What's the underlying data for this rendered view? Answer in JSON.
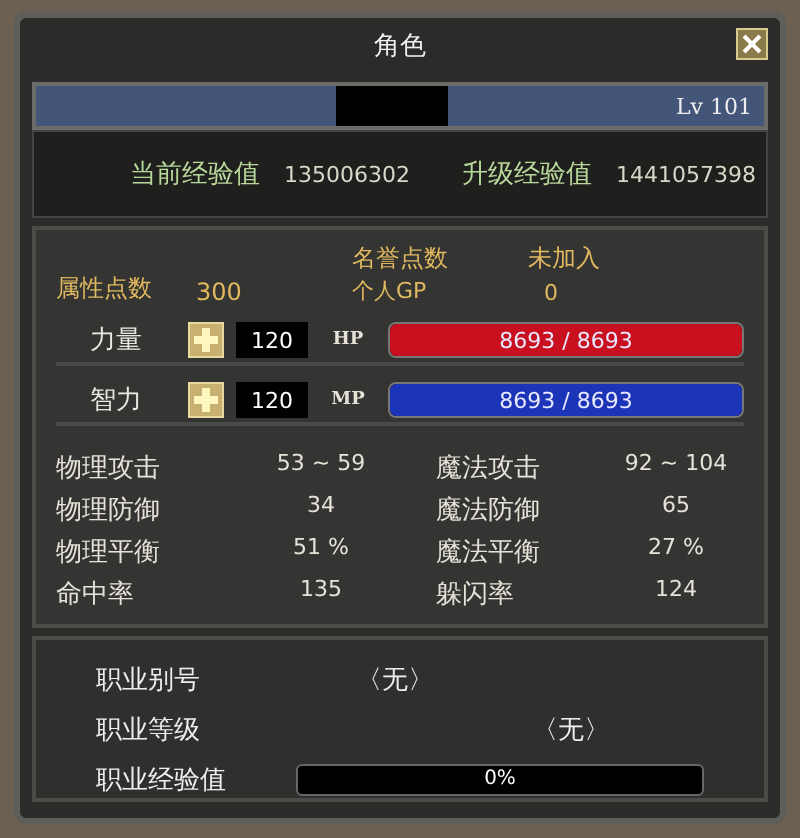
{
  "window": {
    "title": "角色"
  },
  "name_bar": {
    "level_text": "Lv 101"
  },
  "experience": {
    "current_label": "当前经验值",
    "current": "135006302",
    "next_label": "升级经验值",
    "next": "1441057398"
  },
  "points": {
    "label": "属性点数",
    "value": "300",
    "fame_label": "名誉点数",
    "fame_value": "未加入",
    "gp_label": "个人GP",
    "gp_value": "0"
  },
  "attributes": [
    {
      "label": "力量",
      "value": "120",
      "gauge_label": "HP",
      "reading": "8693 / 8693",
      "level": 1,
      "color": "#c8101e"
    },
    {
      "label": "智力",
      "value": "120",
      "gauge_label": "MP",
      "reading": "8693 / 8693",
      "level": 1,
      "color": "#1c34b8"
    }
  ],
  "stats": [
    {
      "label": "物理攻击",
      "value": "53 ~ 59"
    },
    {
      "label": "魔法攻击",
      "value": "92 ~ 104"
    },
    {
      "label": "物理防御",
      "value": "34"
    },
    {
      "label": "魔法防御",
      "value": "65"
    },
    {
      "label": "物理平衡",
      "value": "51 %"
    },
    {
      "label": "魔法平衡",
      "value": "27 %"
    },
    {
      "label": "命中率",
      "value": "135"
    },
    {
      "label": "躲闪率",
      "value": "124"
    }
  ],
  "job": {
    "title_label": "职业别号",
    "title": "〈无〉",
    "grade_label": "职业等级",
    "grade": "〈无〉",
    "exp_label": "职业经验值",
    "exp_reading": "0%",
    "level": 0
  }
}
